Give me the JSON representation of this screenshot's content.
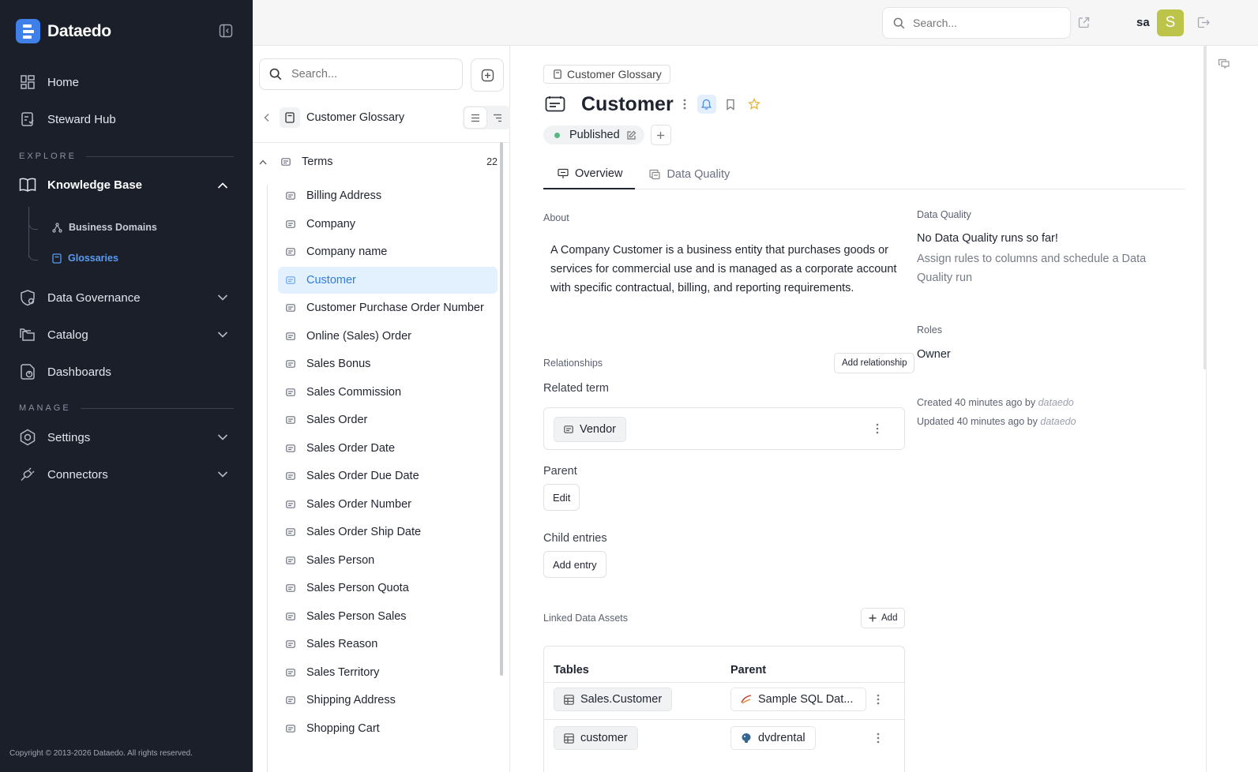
{
  "app": {
    "name": "Dataedo",
    "copyright": "Copyright © 2013-2026 Dataedo. All rights reserved."
  },
  "nav": {
    "home": "Home",
    "steward_hub": "Steward Hub",
    "explore_label": "EXPLORE",
    "knowledge_base": "Knowledge Base",
    "business_domains": "Business Domains",
    "glossaries": "Glossaries",
    "data_governance": "Data Governance",
    "catalog": "Catalog",
    "dashboards": "Dashboards",
    "manage_label": "MANAGE",
    "settings": "Settings",
    "connectors": "Connectors"
  },
  "header": {
    "search_placeholder": "Search...",
    "user": "sa",
    "avatar_letter": "S"
  },
  "tree": {
    "search_placeholder": "Search...",
    "glossary_title": "Customer Glossary",
    "group_label": "Terms",
    "group_count": "22",
    "selected_index": 3,
    "terms": [
      "Billing Address",
      "Company",
      "Company name",
      "Customer",
      "Customer Purchase Order Number",
      "Online (Sales) Order",
      "Sales Bonus",
      "Sales Commission",
      "Sales Order",
      "Sales Order Date",
      "Sales Order Due Date",
      "Sales Order Number",
      "Sales Order Ship Date",
      "Sales Person",
      "Sales Person Quota",
      "Sales Person Sales",
      "Sales Reason",
      "Sales Territory",
      "Shipping Address",
      "Shopping Cart"
    ]
  },
  "main": {
    "breadcrumb": "Customer Glossary",
    "title": "Customer",
    "status": "Published",
    "tabs": [
      "Overview",
      "Data Quality"
    ],
    "about_label": "About",
    "about_text": "A Company Customer is a business entity that purchases goods or services for commercial use and is managed as a corporate account with specific contractual, billing, and reporting requirements.",
    "relationships_label": "Relationships",
    "add_relationship": "Add relationship",
    "related_term_label": "Related term",
    "related_term": "Vendor",
    "parent_label": "Parent",
    "parent_edit": "Edit",
    "child_label": "Child entries",
    "add_entry": "Add entry",
    "linked_label": "Linked Data Assets",
    "add_label": "Add",
    "table_headers": {
      "tables": "Tables",
      "parent": "Parent"
    },
    "linked_rows": [
      {
        "table": "Sales.Customer",
        "parent": "Sample SQL Dat..."
      },
      {
        "table": "customer",
        "parent": "dvdrental"
      }
    ]
  },
  "side": {
    "dq_label": "Data Quality",
    "dq_title": "No Data Quality runs so far!",
    "dq_sub": "Assign rules to columns and schedule a Data Quality run",
    "roles_label": "Roles",
    "owner": "Owner",
    "created": "Created 40 minutes ago by",
    "created_by": "dataedo",
    "updated": "Updated 40 minutes ago by",
    "updated_by": "dataedo"
  },
  "colors": {
    "sidebar_bg": "#1b1f2a",
    "accent": "#3f7fe8",
    "selected_bg": "#e3f0fd",
    "published": "#56b984",
    "avatar": "#bcc44a"
  }
}
